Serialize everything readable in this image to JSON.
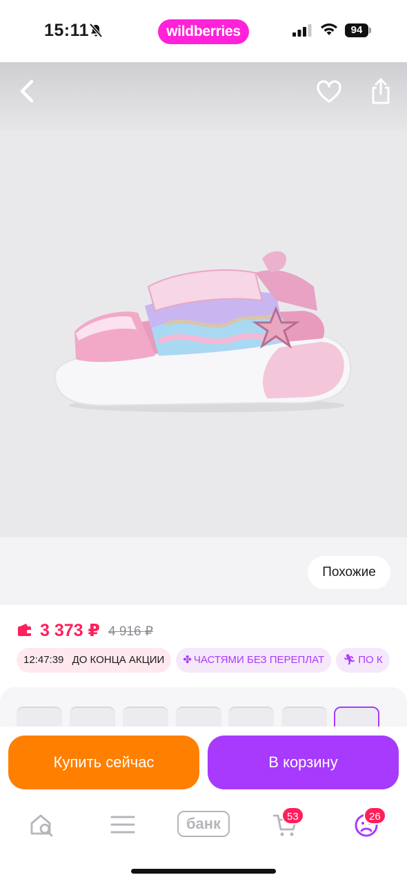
{
  "status_bar": {
    "time": "15:11",
    "brand": "wildberries",
    "battery": "94",
    "brand_color": "#ff22d9"
  },
  "header": {
    "back_icon": "chevron-left-icon",
    "favorite_icon": "heart-icon",
    "share_icon": "share-icon"
  },
  "gallery": {
    "similar_label": "Похожие"
  },
  "price": {
    "current": "3 373 ₽",
    "old": "4 916 ₽",
    "accent_color": "#ff1f5a"
  },
  "badges": {
    "timer": "12:47:39",
    "timer_label": "ДО КОНЦА АКЦИИ",
    "installments": "ЧАСТЯМИ БЕЗ ПЕРЕПЛАТ",
    "delivery_partial": "ПО К"
  },
  "actions": {
    "buy_now": "Купить сейчас",
    "add_to_cart": "В корзину",
    "buy_color": "#ff7f00",
    "cart_color": "#a73afd"
  },
  "tab_bar": {
    "bank_label": "банк",
    "cart_count": "53",
    "profile_count": "26"
  }
}
